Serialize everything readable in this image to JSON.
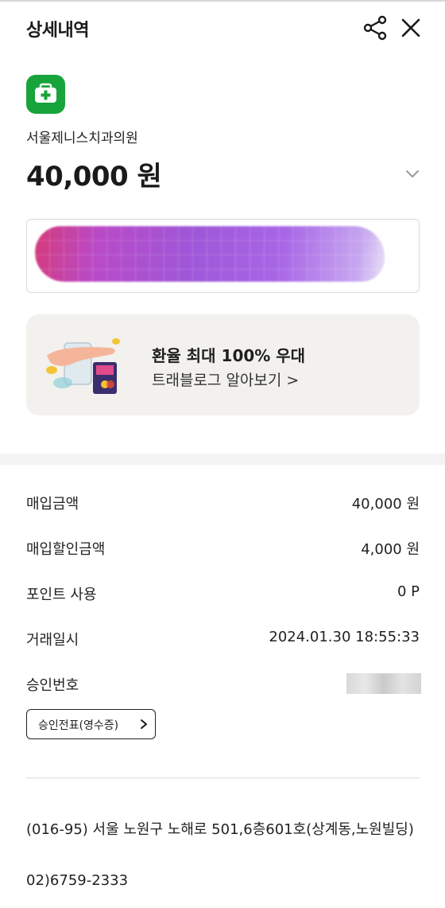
{
  "header": {
    "title": "상세내역",
    "share_icon": "share-icon",
    "close_icon": "close-icon"
  },
  "transaction": {
    "merchant_icon": "medical-kit-icon",
    "merchant_name": "서울제니스치과의원",
    "amount": "40,000 원"
  },
  "promo": {
    "title": "환율 최대 100% 우대",
    "link": "트래블로그 알아보기 >"
  },
  "details": [
    {
      "label": "매입금액",
      "value": "40,000 원"
    },
    {
      "label": "매입할인금액",
      "value": "4,000 원"
    },
    {
      "label": "포인트 사용",
      "value": "0 P"
    },
    {
      "label": "거래일시",
      "value": "2024.01.30 18:55:33"
    },
    {
      "label": "승인번호",
      "value": ""
    }
  ],
  "slip_button": {
    "label": "승인전표(영수증)"
  },
  "merchant_info": {
    "address": "(016-95) 서울 노원구 노해로 501,6층601호(상계동,노원빌딩)",
    "phone": "02)6759-2333"
  },
  "colors": {
    "brand_green": "#17a43a",
    "promo_bg": "#f2f1ee"
  }
}
